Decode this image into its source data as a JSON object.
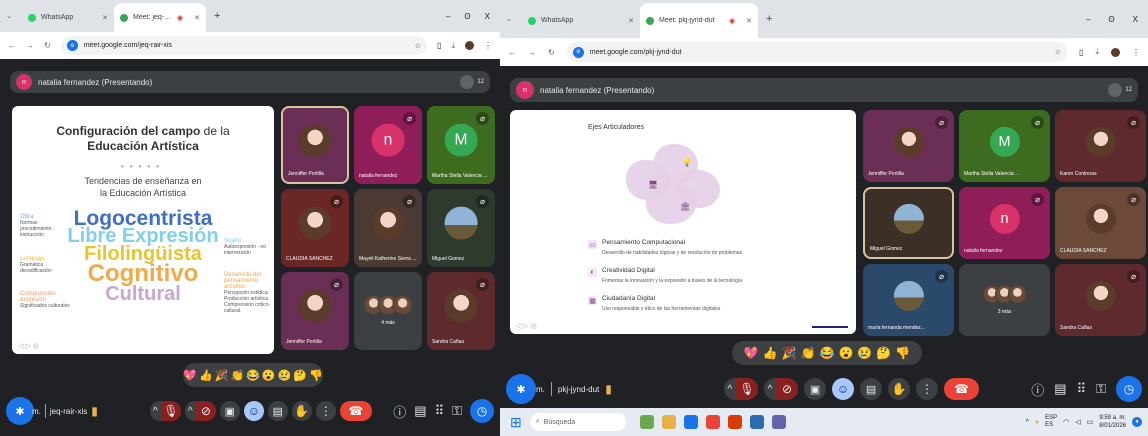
{
  "left": {
    "tabs": [
      {
        "label": "WhatsApp",
        "favicon_color": "#25d366"
      },
      {
        "label": "Meet: jeq-rair-xis",
        "favicon_color": "#34a853"
      }
    ],
    "new_tab": "+",
    "window": {
      "min": "–",
      "max": "ʘ",
      "close": "X"
    },
    "address": {
      "url": "meet.google.com/jeq-rair-xis"
    },
    "presenter": {
      "avatar": "n",
      "label": "natalia fernandez (Presentando)",
      "count": "12"
    },
    "slide": {
      "title_bold": "Configuración del campo",
      "title_rest": " de la",
      "title_line2": "Educación Artística",
      "subtitle1": "Tendencias de enseñanza en",
      "subtitle2": "la Educación Artística",
      "words": [
        "Logocentrista",
        "Libre Expresión",
        "Filolingüista",
        "Cognitivo",
        "Cultural"
      ],
      "left_notes": [
        {
          "title": "Obra",
          "body": "Normas · procedimiento · instrucción"
        },
        {
          "title": "Lenguaje",
          "body": "Gramática · decodificación"
        },
        {
          "title": "Comprensión expresión",
          "body": "Significados culturales"
        }
      ],
      "right_notes": [
        {
          "title": "Sujeto",
          "body": "Autoexpresión · no intervención"
        },
        {
          "title": "Desarrollo del pensamiento artístico",
          "body": "Percepción estética. Producción artística. Comprensión crítico-cultural."
        }
      ]
    },
    "tiles": [
      {
        "name": "Jenniffer Portilla",
        "bg": "#6b2f55",
        "kind": "photo",
        "border": true
      },
      {
        "name": "natalia fernandez",
        "bg": "#8f1d57",
        "kind": "letter",
        "letter": "n",
        "lbg": "#d8326b",
        "mic": true
      },
      {
        "name": "Martha Stella Valencia ...",
        "bg": "#3d6b1f",
        "kind": "letter",
        "letter": "M",
        "lbg": "#34a853",
        "mic": true
      },
      {
        "name": "CLAUDIA SANCHEZ",
        "bg": "#6b2626",
        "kind": "photo",
        "mic": true
      },
      {
        "name": "Mayeli Katherine Sierra ...",
        "bg": "#4a3a33",
        "kind": "photo",
        "mic": true
      },
      {
        "name": "Miguel Gomez",
        "bg": "#2e3a2e",
        "kind": "photo",
        "photo": "land",
        "mic": true
      },
      {
        "name": "Jenniffer Portilla",
        "bg": "#6b2f55",
        "kind": "photo",
        "mic": true
      },
      {
        "name": "4 más",
        "bg": "#3c4043",
        "kind": "group"
      },
      {
        "name": "Sandra Cañas",
        "bg": "#5e2a2e",
        "kind": "photo",
        "mic": true
      }
    ],
    "reactions": [
      "💖",
      "👍",
      "🎉",
      "👏",
      "😂",
      "😮",
      "😢",
      "🤔",
      "👎"
    ],
    "meeting_initial": "m.",
    "meeting_code": "jeq-rair-xis"
  },
  "right": {
    "tabs": [
      {
        "label": "WhatsApp",
        "favicon_color": "#25d366"
      },
      {
        "label": "Meet: pkj-jynd-dut",
        "favicon_color": "#34a853"
      }
    ],
    "new_tab": "+",
    "window": {
      "min": "–",
      "max": "ʘ",
      "close": "X"
    },
    "address": {
      "url": "meet.google.com/pkj-jynd-dut"
    },
    "presenter": {
      "avatar": "n",
      "label": "natalia fernandez (Presentando)",
      "count": "12"
    },
    "slide": {
      "header": "Ejes Articuladores",
      "items": [
        {
          "title": "Pensamiento Computacional",
          "desc": "Desarrollo de habilidades lógicas y de resolución de problemas"
        },
        {
          "title": "Creatividad Digital",
          "desc": "Fomentar la innovación y la expresión a través de la tecnología"
        },
        {
          "title": "Ciudadanía Digital",
          "desc": "Uso responsable y ético de las herramientas digitales"
        }
      ]
    },
    "tiles": [
      {
        "name": "Jenniffer Portilla",
        "bg": "#6b2f55",
        "kind": "photo",
        "mic": true
      },
      {
        "name": "Martha Stella Valencia ...",
        "bg": "#3d6b1f",
        "kind": "letter",
        "letter": "M",
        "lbg": "#34a853",
        "mic": true
      },
      {
        "name": "Karen Contreras",
        "bg": "#5e2a2e",
        "kind": "photo",
        "mic": true
      },
      {
        "name": "Miguel Gomez",
        "bg": "#3c3026",
        "kind": "photo",
        "photo": "land",
        "border": true
      },
      {
        "name": "natalia fernandez",
        "bg": "#8f1d57",
        "kind": "letter",
        "letter": "n",
        "lbg": "#d8326b",
        "mic": true
      },
      {
        "name": "CLAUDIA SANCHEZ",
        "bg": "#6b4a3a",
        "kind": "photo",
        "mic": true
      },
      {
        "name": "maria fernanda mendez...",
        "bg": "#2b4a6b",
        "kind": "photo",
        "photo": "land",
        "mic": true
      },
      {
        "name": "3 más",
        "bg": "#3c4043",
        "kind": "group"
      },
      {
        "name": "Sandra Cañas",
        "bg": "#5e2a2e",
        "kind": "photo",
        "mic": true
      }
    ],
    "reactions": [
      "💖",
      "👍",
      "🎉",
      "👏",
      "😂",
      "😮",
      "😢",
      "🤔",
      "👎"
    ],
    "meeting_initial": "m.",
    "meeting_code": "pkj-jynd-dut"
  },
  "taskbar": {
    "search_placeholder": "Búsqueda",
    "lang_top": "ESP",
    "lang_bottom": "ES",
    "time": "9:59 a. m.",
    "date": "8/01/2026"
  },
  "colors": {
    "accent": "#1a73e8",
    "meet_bg": "#202124",
    "hangup": "#ea4335"
  }
}
